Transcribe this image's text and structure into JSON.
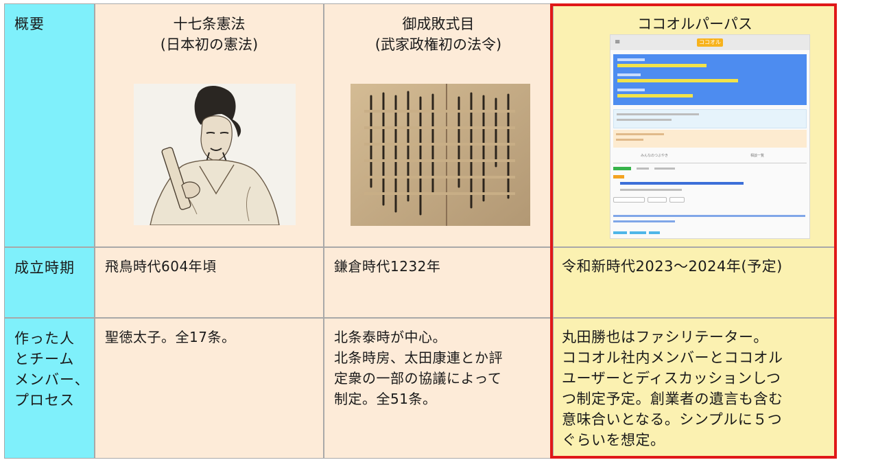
{
  "rows": {
    "header_label": "概要",
    "date_label": "成立時期",
    "people_label": [
      "作った人",
      "とチーム",
      "メンバー、",
      "プロセス"
    ]
  },
  "columns": [
    {
      "title": [
        "十七条憲法",
        "(日本初の憲法)"
      ],
      "image": "shotoku-taishi-portrait",
      "date": "飛鳥時代604年頃",
      "people": [
        "聖徳太子。全17条。"
      ]
    },
    {
      "title": [
        "御成敗式目",
        "(武家政権初の法令)"
      ],
      "image": "goseibai-shikimoku-manuscript",
      "date": "鎌倉時代1232年",
      "people": [
        "北条泰時が中心。",
        "北条時房、太田康連とか評",
        "定衆の一部の協議によって",
        "制定。全51条。"
      ]
    },
    {
      "title": [
        "ココオルパーパス"
      ],
      "image": "cocoor-website-screenshot",
      "date": "令和新時代2023～2024年(予定)",
      "people": [
        "丸田勝也はファシリテーター。",
        "ココオル社内メンバーとココオル",
        "ユーザーとディスカッションしつ",
        "つ制定予定。創業者の遺言も含む",
        "意味合いとなる。シンプルに５つ",
        "ぐらいを想定。"
      ]
    }
  ],
  "screenshot": {
    "logo": "ココオル",
    "tab_left": "みんなのつぶやき",
    "tab_right": "相談一覧"
  },
  "colors": {
    "label_bg": "#7ff0fb",
    "peach_bg": "#fdebd8",
    "yellow_bg": "#fbf1b1",
    "highlight_border": "#e01818"
  }
}
